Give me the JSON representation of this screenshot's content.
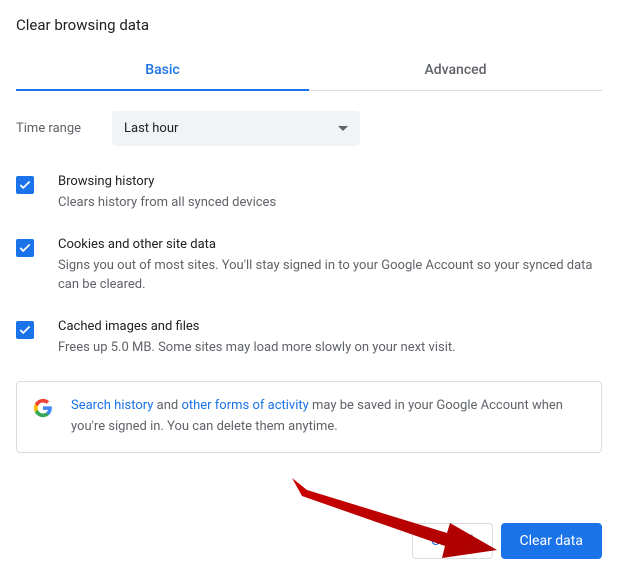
{
  "title": "Clear browsing data",
  "tabs": {
    "basic": "Basic",
    "advanced": "Advanced"
  },
  "time": {
    "label": "Time range",
    "selected": "Last hour"
  },
  "items": [
    {
      "title": "Browsing history",
      "desc": "Clears history from all synced devices"
    },
    {
      "title": "Cookies and other site data",
      "desc": "Signs you out of most sites. You'll stay signed in to your Google Account so your synced data can be cleared."
    },
    {
      "title": "Cached images and files",
      "desc": "Frees up 5.0 MB. Some sites may load more slowly on your next visit."
    }
  ],
  "info": {
    "link1": "Search history",
    "mid1": " and ",
    "link2": "other forms of activity",
    "rest": " may be saved in your Google Account when you're signed in. You can delete them anytime."
  },
  "buttons": {
    "cancel": "Cancel",
    "clear": "Clear data"
  }
}
